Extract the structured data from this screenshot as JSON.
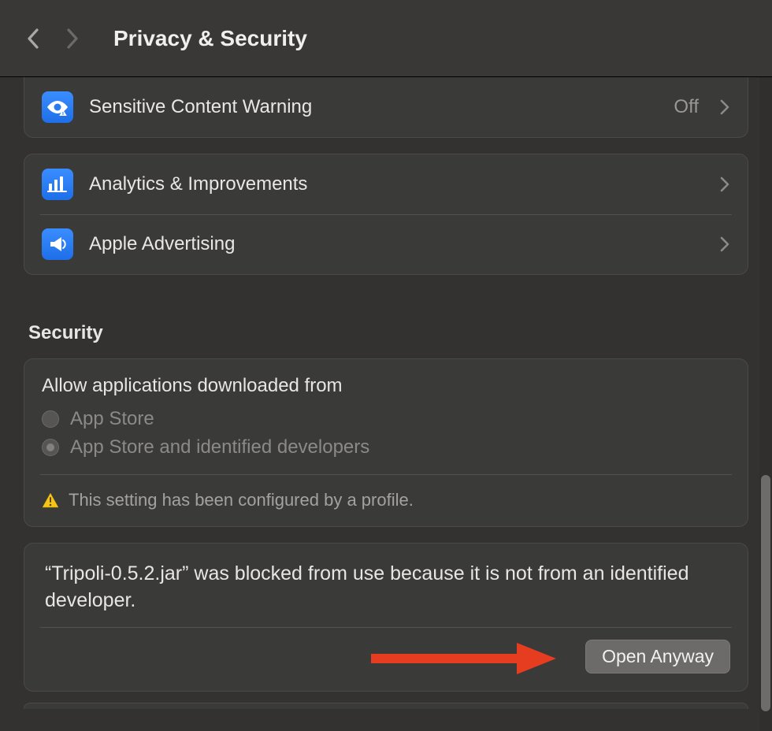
{
  "header": {
    "title": "Privacy & Security"
  },
  "rows": {
    "sensitiveContent": {
      "label": "Sensitive Content Warning",
      "value": "Off"
    },
    "analytics": {
      "label": "Analytics & Improvements"
    },
    "advertising": {
      "label": "Apple Advertising"
    }
  },
  "security": {
    "heading": "Security",
    "allowTitle": "Allow applications downloaded from",
    "options": {
      "appStore": "App Store",
      "identified": "App Store and identified developers"
    },
    "profileWarning": "This setting has been configured by a profile.",
    "blockedMessage": "“Tripoli-0.5.2.jar” was blocked from use because it is not from an identified developer.",
    "openAnyway": "Open Anyway"
  },
  "icons": {
    "sensitive": "eye-warning-icon",
    "analytics": "bar-chart-icon",
    "advertising": "megaphone-icon"
  },
  "colors": {
    "accent": "#2a7bf0",
    "warn": "#f5c518",
    "arrow": "#e63c1f"
  }
}
